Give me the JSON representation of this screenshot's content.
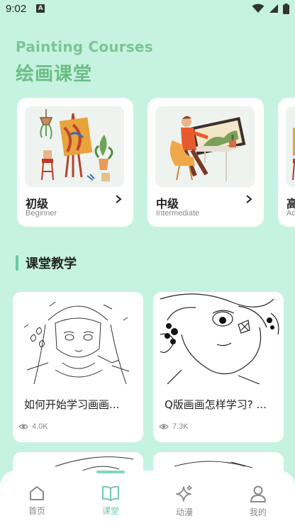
{
  "status_bar": {
    "time": "9:02",
    "notification_icon": "a-app-icon",
    "icons": [
      "wifi-icon",
      "signal-icon",
      "battery-icon"
    ]
  },
  "header": {
    "title_en": "Painting Courses",
    "title_cn": "绘画课堂"
  },
  "courses": [
    {
      "name": "初级",
      "sub": "Beginner"
    },
    {
      "name": "中级",
      "sub": "Intermediate"
    },
    {
      "name": "高",
      "sub": "Ac"
    }
  ],
  "section": {
    "title": "课堂教学"
  },
  "lessons": [
    {
      "title": "如何开始学习画画...",
      "views": "4.0K"
    },
    {
      "title": "Q版画画怎样学习? ...",
      "views": "7.3K"
    }
  ],
  "tabbar": {
    "items": [
      {
        "label": "首页",
        "icon": "home-icon",
        "active": false
      },
      {
        "label": "课堂",
        "icon": "book-icon",
        "active": true
      },
      {
        "label": "动漫",
        "icon": "sparkle-icon",
        "active": false
      },
      {
        "label": "我的",
        "icon": "user-icon",
        "active": false
      }
    ]
  },
  "colors": {
    "background": "#c6f3e1",
    "accent": "#72c8ad",
    "title_green": "#6cbd84"
  }
}
